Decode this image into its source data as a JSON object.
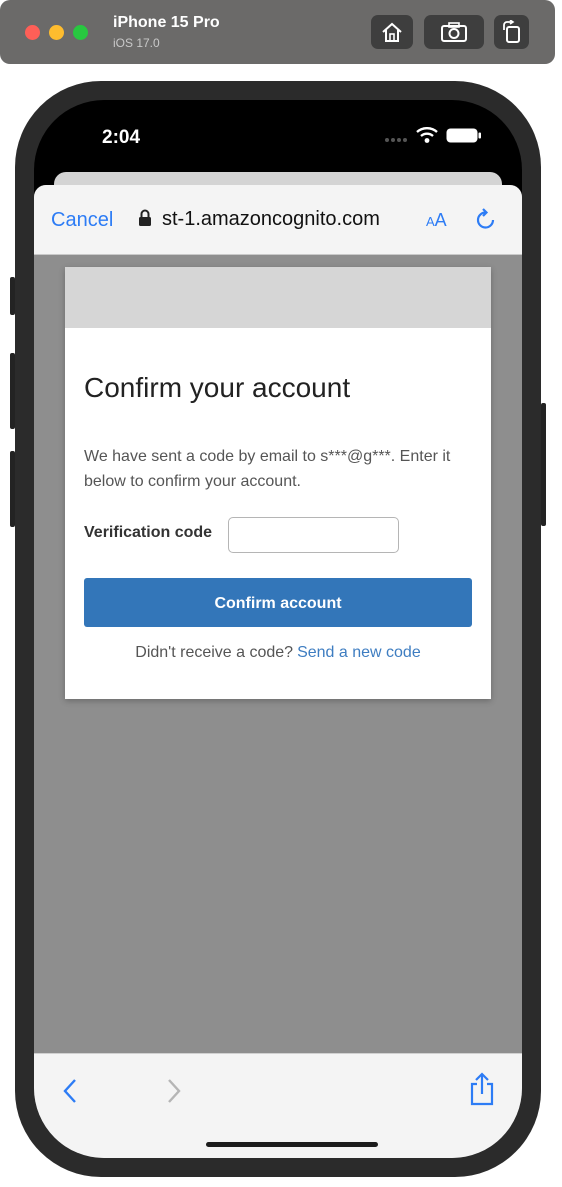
{
  "simulator": {
    "device_name": "iPhone 15 Pro",
    "os_version": "iOS 17.0",
    "icons": [
      "home-icon",
      "screenshot-icon",
      "rotate-icon"
    ]
  },
  "status_bar": {
    "time": "2:04",
    "icons": [
      "wifi-icon",
      "battery-icon"
    ]
  },
  "browser": {
    "cancel_label": "Cancel",
    "url": "st-1.amazoncognito.com",
    "text_size_label_small": "A",
    "text_size_label_large": "A"
  },
  "page": {
    "title": "Confirm your account",
    "message": "We have sent a code by email to s***@g***. Enter it below to confirm your account.",
    "verification_label": "Verification code",
    "verification_value": "",
    "confirm_button": "Confirm account",
    "resend_prompt": "Didn't receive a code?",
    "resend_link": "Send a new code"
  },
  "colors": {
    "accent": "#2d7cf5",
    "primary_button": "#3376b9",
    "link": "#3e7dc1",
    "overlay": "#8e8e8e"
  }
}
